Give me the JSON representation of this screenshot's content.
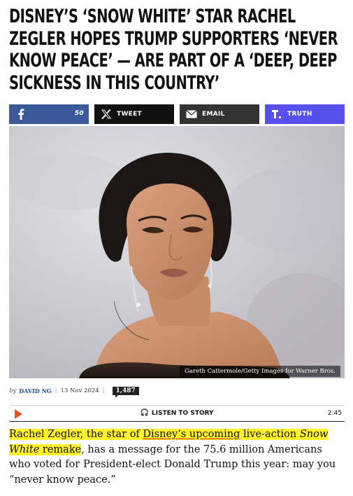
{
  "headline": "Disney’s ‘Snow White’ Star Rachel Zegler Hopes Trump Supporters ‘Never Know Peace’ — Are Part of a ‘Deep, Deep Sickness in This Country’",
  "share": {
    "facebook_count": "50",
    "tweet_label": "TWEET",
    "email_label": "EMAIL",
    "truth_label": "TRUTH",
    "icons": [
      "facebook-icon",
      "x-icon",
      "envelope-icon",
      "truth-social-icon"
    ],
    "colors": {
      "facebook": "#3b5998",
      "tweet": "#111111",
      "email": "#333333",
      "truth": "#5850ec"
    }
  },
  "image": {
    "credit": "Gareth Cattermole/Getty Images for Warner Bros."
  },
  "byline": {
    "by": "by",
    "author": "DAVID NG",
    "date": "13 Nov 2024",
    "comments": "1,487"
  },
  "audio": {
    "listen_label": "LISTEN TO STORY",
    "duration": "2:45",
    "play_color": "#e8521f"
  },
  "article": {
    "part1": "Rachel Zegler, the star of ",
    "link_text": "Disney’s upcoming",
    "part2": " live-action ",
    "italic_title": "Snow White",
    "part3": " remake",
    "part4": ", has a message for the 75.6 million Americans who voted for President-elect Donald Trump this year: may you “never know peace.”"
  }
}
